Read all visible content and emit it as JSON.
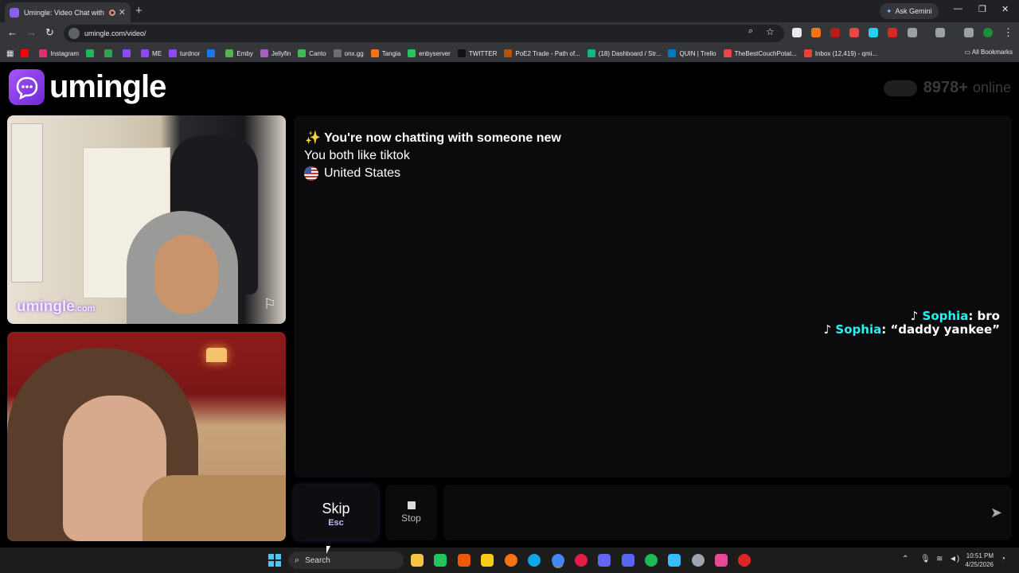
{
  "browser": {
    "tab_title": "Umingle: Video Chat with S",
    "new_tab": "+",
    "ask_gemini": "Ask Gemini",
    "url": "umingle.com/video/",
    "bookmarks": [
      {
        "label": "",
        "color": "#ff0000"
      },
      {
        "label": "Instagram",
        "color": "#e1306c"
      },
      {
        "label": "",
        "color": "#1db954"
      },
      {
        "label": "",
        "color": "#2ea44f"
      },
      {
        "label": "",
        "color": "#9146ff"
      },
      {
        "label": "ME",
        "color": "#9146ff"
      },
      {
        "label": "turdnor",
        "color": "#9146ff"
      },
      {
        "label": "",
        "color": "#1877f2"
      },
      {
        "label": "Emby",
        "color": "#52b54b"
      },
      {
        "label": "Jellyfin",
        "color": "#aa5cc3"
      },
      {
        "label": "Canto",
        "color": "#3fb950"
      },
      {
        "label": "onx.gg",
        "color": "#6e6e6e"
      },
      {
        "label": "Tangia",
        "color": "#f97316"
      },
      {
        "label": "enbyserver",
        "color": "#22c55e"
      },
      {
        "label": "TWITTER",
        "color": "#111111"
      },
      {
        "label": "PoE2 Trade - Path of...",
        "color": "#b45309"
      },
      {
        "label": "(18) Dashboard / Str...",
        "color": "#10b981"
      },
      {
        "label": "QUIN | Trello",
        "color": "#0079bf"
      },
      {
        "label": "TheBestCouchPotat...",
        "color": "#ef4444"
      },
      {
        "label": "Inbox (12,419) - qmi...",
        "color": "#ea4335"
      }
    ],
    "all_bookmarks": "All Bookmarks"
  },
  "site": {
    "logo_text": "umingle",
    "online_count": "8978+",
    "online_label": "online",
    "watermark": "umingle",
    "watermark_suffix": ".com"
  },
  "chat": {
    "header": "✨ You're now chatting with someone new",
    "interest": "You both like tiktok",
    "country": "United States",
    "tiktok_messages": [
      {
        "name": "Sophia",
        "text": ": bro"
      },
      {
        "name": "Sophia",
        "text": ": “daddy yankee”"
      }
    ]
  },
  "controls": {
    "skip_label": "Skip",
    "skip_key": "Esc",
    "stop_label": "Stop",
    "message_placeholder": "",
    "send_icon": "➤"
  },
  "taskbar": {
    "search_label": "Search",
    "time": "10:51 PM",
    "date": "4/25/2026"
  },
  "colors": {
    "brand": "#8b5cf6",
    "tiktok_name": "#25f4ee"
  }
}
